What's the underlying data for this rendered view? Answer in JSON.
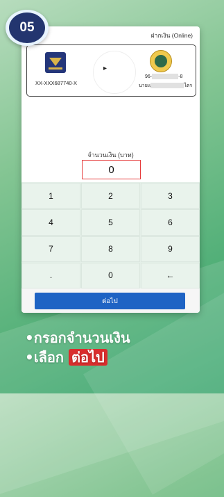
{
  "step": {
    "number": "05"
  },
  "screen": {
    "title": "ฝากเงิน (Online)"
  },
  "transfer": {
    "from_account": "XX-XXX687740-X",
    "arrow": "▸",
    "to_account_prefix": "96-",
    "to_account_suffix": "-8",
    "to_name_prefix": "นายแ",
    "to_name_suffix": "ไตร"
  },
  "amount": {
    "label": "จำนวนเงิน (บาท)",
    "value": "0"
  },
  "keypad": {
    "keys": [
      "1",
      "2",
      "3",
      "4",
      "5",
      "6",
      "7",
      "8",
      "9",
      ".",
      "0",
      "←"
    ]
  },
  "actions": {
    "next_label": "ต่อไป"
  },
  "instructions": {
    "bullet": "•",
    "line1": "กรอกจำนวนเงิน",
    "line2_prefix": "เลือก",
    "line2_highlight": "ต่อไป"
  },
  "colors": {
    "accent": "#1e63c4",
    "highlight": "#d92d2d",
    "badge": "#23356f",
    "amount_border": "#e53a3a"
  }
}
